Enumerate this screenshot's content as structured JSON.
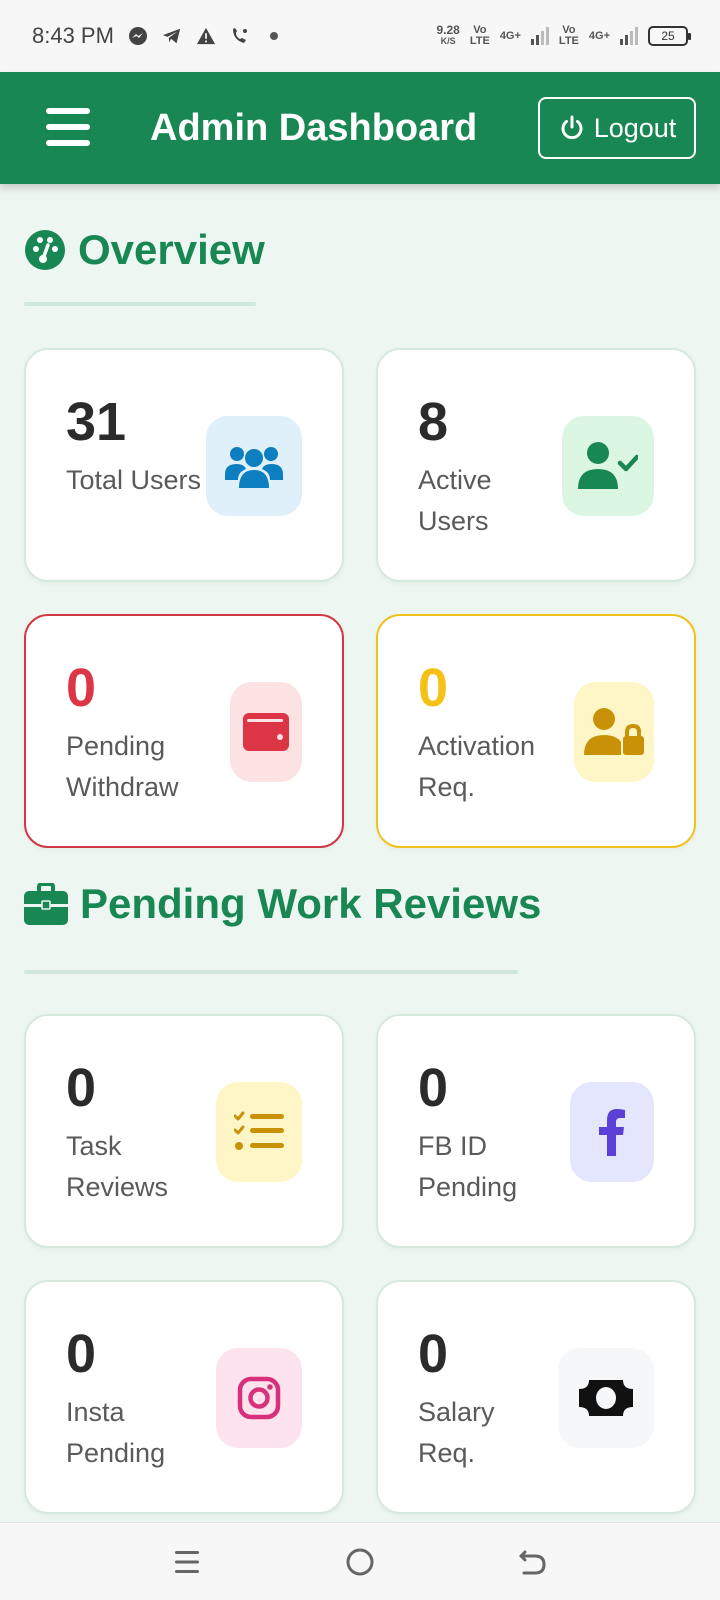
{
  "status_bar": {
    "time": "8:43 PM",
    "net_speed_value": "9.28",
    "net_speed_unit": "K/S",
    "sim1_label_top": "Vo",
    "sim1_label_bottom": "LTE",
    "sim1_network": "4G+",
    "sim2_label_top": "Vo",
    "sim2_label_bottom": "LTE",
    "sim2_network": "4G+",
    "battery": "25"
  },
  "header": {
    "title": "Admin Dashboard",
    "logout_label": "Logout"
  },
  "overview": {
    "heading": "Overview",
    "cards": [
      {
        "value": "31",
        "label": "Total Users",
        "icon": "users-icon",
        "accent": "#0d7fc1",
        "icon_bg": "#dff0fb"
      },
      {
        "value": "8",
        "label": "Active Users",
        "icon": "user-check-icon",
        "accent": "#198754",
        "icon_bg": "#dcf6e4"
      },
      {
        "value": "0",
        "label": "Pending Withdraw",
        "icon": "wallet-icon",
        "accent": "#dc3545",
        "icon_bg": "#fde2e3"
      },
      {
        "value": "0",
        "label": "Activation Req.",
        "icon": "user-lock-icon",
        "accent": "#c99108",
        "icon_bg": "#fff6c8"
      }
    ]
  },
  "work_reviews": {
    "heading": "Pending Work Reviews",
    "cards": [
      {
        "value": "0",
        "label": "Task Reviews",
        "icon": "list-check-icon",
        "accent": "#c99108",
        "icon_bg": "#fff6c8"
      },
      {
        "value": "0",
        "label": "FB ID Pending",
        "icon": "facebook-icon",
        "accent": "#5b3fd6",
        "icon_bg": "#e3e6fc"
      },
      {
        "value": "0",
        "label": "Insta Pending",
        "icon": "instagram-icon",
        "accent": "#d6317a",
        "icon_bg": "#fde3ee"
      },
      {
        "value": "0",
        "label": "Salary Req.",
        "icon": "money-bill-icon",
        "accent": "#111111",
        "icon_bg": "#f6f7f8"
      }
    ]
  }
}
